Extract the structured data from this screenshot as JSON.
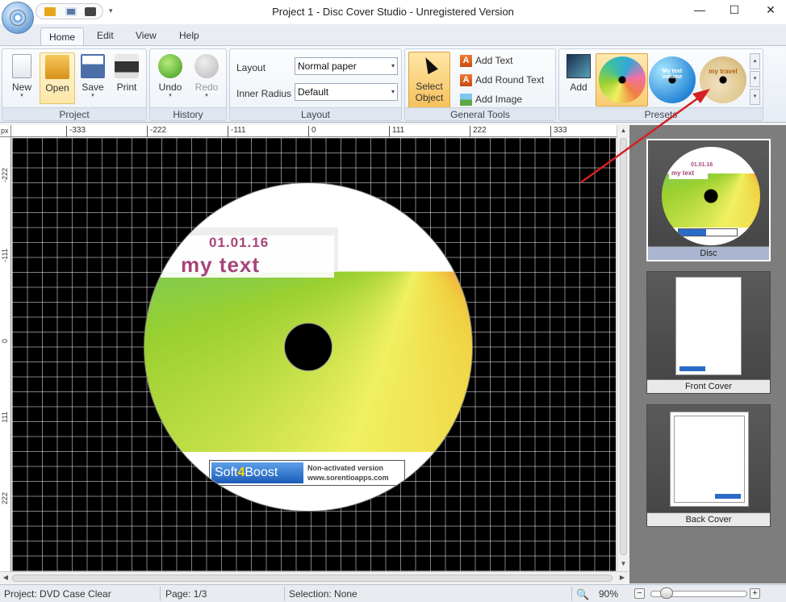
{
  "window": {
    "title": "Project 1 - Disc Cover Studio - Unregistered Version",
    "minimize": "—",
    "maximize": "☐",
    "close": "✕",
    "qat_more": "▾"
  },
  "tabs": [
    {
      "label": "Home",
      "active": true
    },
    {
      "label": "Edit"
    },
    {
      "label": "View"
    },
    {
      "label": "Help"
    }
  ],
  "ribbon": {
    "project": {
      "label": "Project",
      "new": "New",
      "open": "Open",
      "save": "Save",
      "print": "Print",
      "drop": "▾"
    },
    "history": {
      "label": "History",
      "undo": "Undo",
      "redo": "Redo",
      "drop": "▾"
    },
    "layout": {
      "label": "Layout",
      "layout_label": "Layout",
      "layout_value": "Normal paper",
      "inner_radius_label": "Inner Radius",
      "inner_radius_value": "Default",
      "arrow": "▾"
    },
    "general_tools": {
      "label": "General Tools",
      "select_object_line1": "Select",
      "select_object_line2": "Object",
      "add_text": "Add Text",
      "add_round_text": "Add Round Text",
      "add_image": "Add Image",
      "icon_letter": "A"
    },
    "presets": {
      "label": "Presets",
      "add": "Add",
      "thumb2_text": "My text\nvolume",
      "thumb3_text": "my travel",
      "up": "▴",
      "down": "▾",
      "more": "▾"
    }
  },
  "rulers": {
    "unit": "px",
    "h_ticks": [
      "-333",
      "-222",
      "-111",
      "0",
      "111",
      "222",
      "333"
    ],
    "v_ticks": [
      "-222",
      "-111",
      "0",
      "111",
      "222"
    ]
  },
  "disc": {
    "date": "01.01.16",
    "text": "my text",
    "logo_soft": "Soft",
    "logo_4": "4",
    "logo_boost": "Boost",
    "watermark1": "Non-activated version",
    "watermark2": "www.sorentioapps.com"
  },
  "pages": [
    {
      "label": "Disc",
      "selected": true
    },
    {
      "label": "Front Cover"
    },
    {
      "label": "Back Cover"
    }
  ],
  "scroll": {
    "up": "▲",
    "down": "▼",
    "left": "◀",
    "right": "▶"
  },
  "status": {
    "project": "Project: DVD Case Clear",
    "page": "Page: 1/3",
    "selection": "Selection: None",
    "zoom": "90%",
    "zoom_minus": "−",
    "zoom_plus": "+"
  },
  "colors": {
    "accent": "#f6c15c",
    "disc_text": "#a8447a",
    "annotation_arrow": "#d42020"
  }
}
